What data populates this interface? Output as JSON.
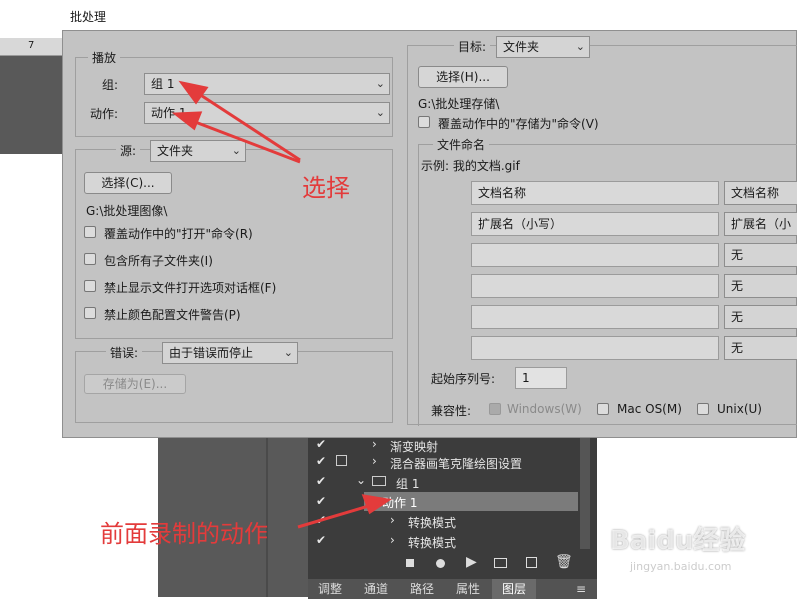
{
  "ruler": {
    "mark": "7"
  },
  "dialog": {
    "title": "批处理",
    "play": {
      "legend": "播放",
      "group_label": "组:",
      "group_value": "组 1",
      "action_label": "动作:",
      "action_value": "动作 1"
    },
    "source": {
      "label": "源:",
      "value": "文件夹",
      "choose_button": "选择(C)...",
      "path": "G:\\批处理图像\\",
      "checkboxes": [
        "覆盖动作中的\"打开\"命令(R)",
        "包含所有子文件夹(I)",
        "禁止显示文件打开选项对话框(F)",
        "禁止颜色配置文件警告(P)"
      ]
    },
    "errors": {
      "label": "错误:",
      "value": "由于错误而停止",
      "save_as_button": "存储为(E)..."
    },
    "target": {
      "label": "目标:",
      "value": "文件夹",
      "choose_button": "选择(H)...",
      "path": "G:\\批处理存储\\",
      "override_checkbox": "覆盖动作中的\"存储为\"命令(V)"
    },
    "naming": {
      "legend": "文件命名",
      "example": "示例: 我的文档.gif",
      "rows": [
        {
          "field": "文档名称",
          "select": "文档名称"
        },
        {
          "field": "扩展名（小写）",
          "select": "扩展名（小"
        },
        {
          "field": "",
          "select": "无"
        },
        {
          "field": "",
          "select": "无"
        },
        {
          "field": "",
          "select": "无"
        },
        {
          "field": "",
          "select": "无"
        }
      ],
      "serial_label": "起始序列号:",
      "serial_value": "1",
      "compat_label": "兼容性:",
      "compat_options": [
        "Windows(W)",
        "Mac OS(M)",
        "Unix(U)"
      ]
    }
  },
  "annotations": {
    "select_text": "选择",
    "recorded_text": "前面录制的动作"
  },
  "actions_panel": {
    "rows": [
      {
        "label": "渐变映射",
        "indent": 2
      },
      {
        "label": "混合器画笔克隆绘图设置",
        "indent": 2
      },
      {
        "label": "组 1",
        "indent": 1
      },
      {
        "label": "动作 1",
        "indent": 2
      },
      {
        "label": "转换模式",
        "indent": 3
      },
      {
        "label": "转换模式",
        "indent": 3
      }
    ],
    "tabs": [
      "调整",
      "通道",
      "路径",
      "属性",
      "图层"
    ]
  },
  "watermark": {
    "brand": "Baidu经验",
    "url": "jingyan.baidu.com"
  },
  "colors": {
    "annotation": "#e33b3b",
    "dialog_bg": "#c3c3c3",
    "panel_bg": "#3c3c3c"
  }
}
